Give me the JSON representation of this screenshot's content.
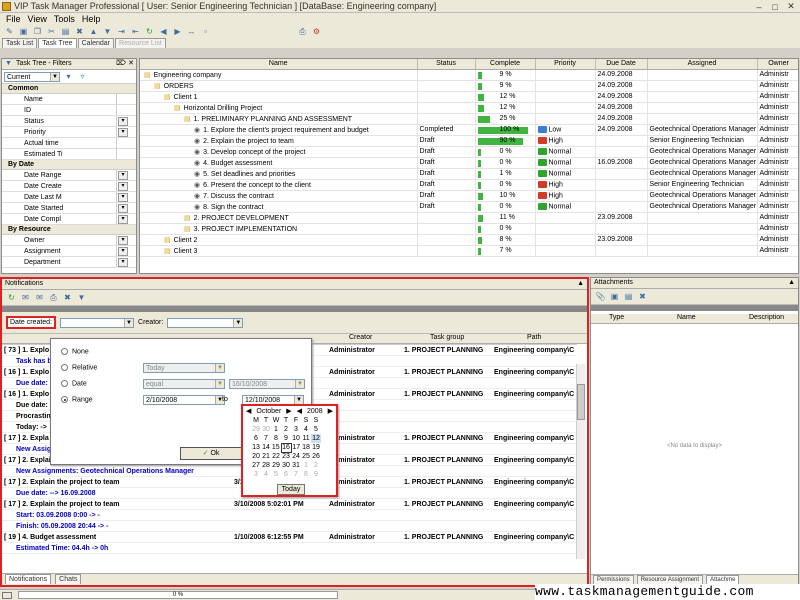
{
  "app": {
    "title": "VIP Task Manager Professional [ User: Senior Engineering Technician ] [DataBase: Engineering company]"
  },
  "menu": [
    "File",
    "View",
    "Tools",
    "Help"
  ],
  "tabs": [
    {
      "label": "Task List"
    },
    {
      "label": "Task Tree"
    },
    {
      "label": "Calendar"
    },
    {
      "label": "Resource List"
    }
  ],
  "filters": {
    "title": "Task Tree - Filters",
    "current": "Current",
    "sections": [
      {
        "name": "Common",
        "items": [
          "Name",
          "ID",
          "Status",
          "Priority",
          "Actual time",
          "Estimated Ti"
        ]
      },
      {
        "name": "By Date",
        "items": [
          "Date Range",
          "Date Create",
          "Date Last M",
          "Date Started",
          "Date Compl"
        ]
      },
      {
        "name": "By Resource",
        "items": [
          "Owner",
          "Assignment",
          "Department"
        ]
      }
    ]
  },
  "tree": {
    "columns": [
      "Name",
      "Status",
      "Complete",
      "Priority",
      "Due Date",
      "Assigned",
      "Owner"
    ],
    "rows": [
      {
        "indent": 0,
        "name": "Engineering company",
        "status": "",
        "complete": "9 %",
        "pct": 9,
        "priority": "",
        "due": "24.09.2008",
        "assigned": "",
        "owner": "Administr"
      },
      {
        "indent": 1,
        "name": "ORDERS",
        "status": "",
        "complete": "9 %",
        "pct": 9,
        "priority": "",
        "due": "24.09.2008",
        "assigned": "",
        "owner": "Administr"
      },
      {
        "indent": 2,
        "name": "Client 1",
        "status": "",
        "complete": "12 %",
        "pct": 12,
        "priority": "",
        "due": "24.09.2008",
        "assigned": "",
        "owner": "Administr"
      },
      {
        "indent": 3,
        "name": "Horizontal Drilling Project",
        "status": "",
        "complete": "12 %",
        "pct": 12,
        "priority": "",
        "due": "24.09.2008",
        "assigned": "",
        "owner": "Administr"
      },
      {
        "indent": 4,
        "name": "1. PRELIMINARY PLANNING AND ASSESSMENT",
        "status": "",
        "complete": "25 %",
        "pct": 25,
        "priority": "",
        "due": "24.09.2008",
        "assigned": "",
        "owner": "Administr"
      },
      {
        "indent": 5,
        "name": "1. Explore the client's project requirement and budget",
        "status": "Completed",
        "complete": "100 %",
        "pct": 100,
        "priority": "Low",
        "pcolor": "#3a7fd5",
        "due": "24.09.2008",
        "assigned": "Geotechnical Operations Manager",
        "owner": "Administr"
      },
      {
        "indent": 5,
        "name": "2. Explain the project to team",
        "status": "Draft",
        "complete": "90 %",
        "pct": 90,
        "priority": "High",
        "pcolor": "#d23a2a",
        "due": "",
        "assigned": "Senior Engineering Technician",
        "owner": "Administr"
      },
      {
        "indent": 5,
        "name": "3. Develop concept of the project",
        "status": "Draft",
        "complete": "0 %",
        "pct": 0,
        "priority": "Normal",
        "pcolor": "#2fa52f",
        "due": "",
        "assigned": "Geotechnical Operations Manager",
        "owner": "Administr"
      },
      {
        "indent": 5,
        "name": "4. Budget assessment",
        "status": "Draft",
        "complete": "0 %",
        "pct": 0,
        "priority": "Normal",
        "pcolor": "#2fa52f",
        "due": "16.09.2008",
        "assigned": "Geotechnical Operations Manager",
        "owner": "Administr"
      },
      {
        "indent": 5,
        "name": "5. Set deadlines and priorities",
        "status": "Draft",
        "complete": "1 %",
        "pct": 1,
        "priority": "Normal",
        "pcolor": "#2fa52f",
        "due": "",
        "assigned": "Geotechnical Operations Manager",
        "owner": "Administr"
      },
      {
        "indent": 5,
        "name": "6. Present the concept to the client",
        "status": "Draft",
        "complete": "0 %",
        "pct": 0,
        "priority": "High",
        "pcolor": "#d23a2a",
        "due": "",
        "assigned": "Senior Engineering Technician",
        "owner": "Administr"
      },
      {
        "indent": 5,
        "name": "7. Discuss the contract",
        "status": "Draft",
        "complete": "10 %",
        "pct": 10,
        "priority": "High",
        "pcolor": "#d23a2a",
        "due": "",
        "assigned": "Geotechnical Operations Manager",
        "owner": "Administr"
      },
      {
        "indent": 5,
        "name": "8. Sign the contract",
        "status": "Draft",
        "complete": "0 %",
        "pct": 0,
        "priority": "Normal",
        "pcolor": "#2fa52f",
        "due": "",
        "assigned": "Geotechnical Operations Manager",
        "owner": "Administr"
      },
      {
        "indent": 4,
        "name": "2. PROJECT DEVELOPMENT",
        "status": "",
        "complete": "11 %",
        "pct": 11,
        "priority": "",
        "due": "23.09.2008",
        "assigned": "",
        "owner": "Administr"
      },
      {
        "indent": 4,
        "name": "3. PROJECT IMPLEMENTATION",
        "status": "",
        "complete": "0 %",
        "pct": 0,
        "priority": "",
        "due": "",
        "assigned": "",
        "owner": "Administr"
      },
      {
        "indent": 2,
        "name": "Client 2",
        "status": "",
        "complete": "8 %",
        "pct": 8,
        "priority": "",
        "due": "23.09.2008",
        "assigned": "",
        "owner": "Administr"
      },
      {
        "indent": 2,
        "name": "Client 3",
        "status": "",
        "complete": "7 %",
        "pct": 7,
        "priority": "",
        "due": "",
        "assigned": "",
        "owner": "Administr"
      }
    ]
  },
  "notifications": {
    "title": "Notifications",
    "date_created_label": "Date created:",
    "creator_label": "Creator:",
    "columns": [
      "Creator",
      "Task group",
      "Path"
    ],
    "rows": [
      {
        "type": "main",
        "text": "[ 73 ] 1. Explo",
        "date": "",
        "creator": "Administrator",
        "group": "1. PROJECT PLANNING",
        "path": "Engineering company\\C"
      },
      {
        "type": "sub",
        "text": "Task has b"
      },
      {
        "type": "main",
        "text": "[ 16 ] 1. Explo",
        "date": "",
        "creator": "Administrator",
        "group": "1. PROJECT PLANNING",
        "path": "Engineering company\\C"
      },
      {
        "type": "sub",
        "text": "Due date:"
      },
      {
        "type": "main",
        "text": "[ 16 ] 1. Explo",
        "date": "",
        "creator": "Administrator",
        "group": "1. PROJECT PLANNING",
        "path": "Engineering company\\C"
      },
      {
        "type": "plain",
        "text": "Due date:"
      },
      {
        "type": "plain",
        "text": "Procrastin"
      },
      {
        "type": "plain",
        "text": "Today: ->"
      },
      {
        "type": "main",
        "text": "[ 17 ] 2. Expla",
        "date": "",
        "creator": "Administrator",
        "group": "1. PROJECT PLANNING",
        "path": "Engineering company\\C"
      },
      {
        "type": "sub",
        "text": "New Assignments: Roger Mavis"
      },
      {
        "type": "main",
        "text": "[ 17 ] 2. Explain the project to team",
        "date": "3",
        "creator": "Administrator",
        "group": "1. PROJECT PLANNING",
        "path": "Engineering company\\C"
      },
      {
        "type": "sub",
        "text": "New Assignments: Geotechnical Operations Manager"
      },
      {
        "type": "main",
        "text": "[ 17 ] 2. Explain the project to team",
        "date": "3/10/2008 5:02:04 PM",
        "creator": "Administrator",
        "group": "1. PROJECT PLANNING",
        "path": "Engineering company\\C"
      },
      {
        "type": "sub",
        "text": "Due date: --> 16.09.2008"
      },
      {
        "type": "main",
        "text": "[ 17 ] 2. Explain the project to team",
        "date": "3/10/2008 5:02:01 PM",
        "creator": "Administrator",
        "group": "1. PROJECT PLANNING",
        "path": "Engineering company\\C"
      },
      {
        "type": "sub",
        "text": "Start: 03.09.2008 0:00 -> -"
      },
      {
        "type": "sub",
        "text": "Finish: 05.09.2008 20:44 -> -"
      },
      {
        "type": "main",
        "text": "[ 19 ] 4. Budget assessment",
        "date": "1/10/2008 6:12:55 PM",
        "creator": "Administrator",
        "group": "1. PROJECT PLANNING",
        "path": "Engineering company\\C"
      },
      {
        "type": "sub",
        "text": "Estimated Time: 04.4h -> 0h"
      }
    ],
    "bottom_tabs": [
      "Notifications",
      "Chats"
    ]
  },
  "datefilter": {
    "options": [
      "None",
      "Relative",
      "Date",
      "Range"
    ],
    "relative_value": "Today",
    "date_op": "equal",
    "date_value": "16/10/2008",
    "range_from": "2/10/2008",
    "range_to_label": "to",
    "range_to": "12/10/2008",
    "ok_label": "Ok"
  },
  "calendar": {
    "month": "October",
    "year": "2008",
    "days_header": [
      "M",
      "T",
      "W",
      "T",
      "F",
      "S",
      "S"
    ],
    "weeks": [
      [
        "29",
        "30",
        "1",
        "2",
        "3",
        "4",
        "5"
      ],
      [
        "6",
        "7",
        "8",
        "9",
        "10",
        "11",
        "12"
      ],
      [
        "13",
        "14",
        "15",
        "16",
        "17",
        "18",
        "19"
      ],
      [
        "20",
        "21",
        "22",
        "23",
        "24",
        "25",
        "26"
      ],
      [
        "27",
        "28",
        "29",
        "30",
        "31",
        "1",
        "2"
      ],
      [
        "3",
        "4",
        "5",
        "6",
        "7",
        "8",
        "9"
      ]
    ],
    "today_label": "Today"
  },
  "attachments": {
    "title": "Attachments",
    "columns": [
      "Type",
      "Name",
      "Description"
    ],
    "empty": "<No data to display>",
    "tabs": [
      "Permissions",
      "Resource Assignment",
      "Attachme"
    ]
  },
  "status": {
    "progress": "0 %"
  },
  "watermark": "www.taskmanagementguide.com"
}
